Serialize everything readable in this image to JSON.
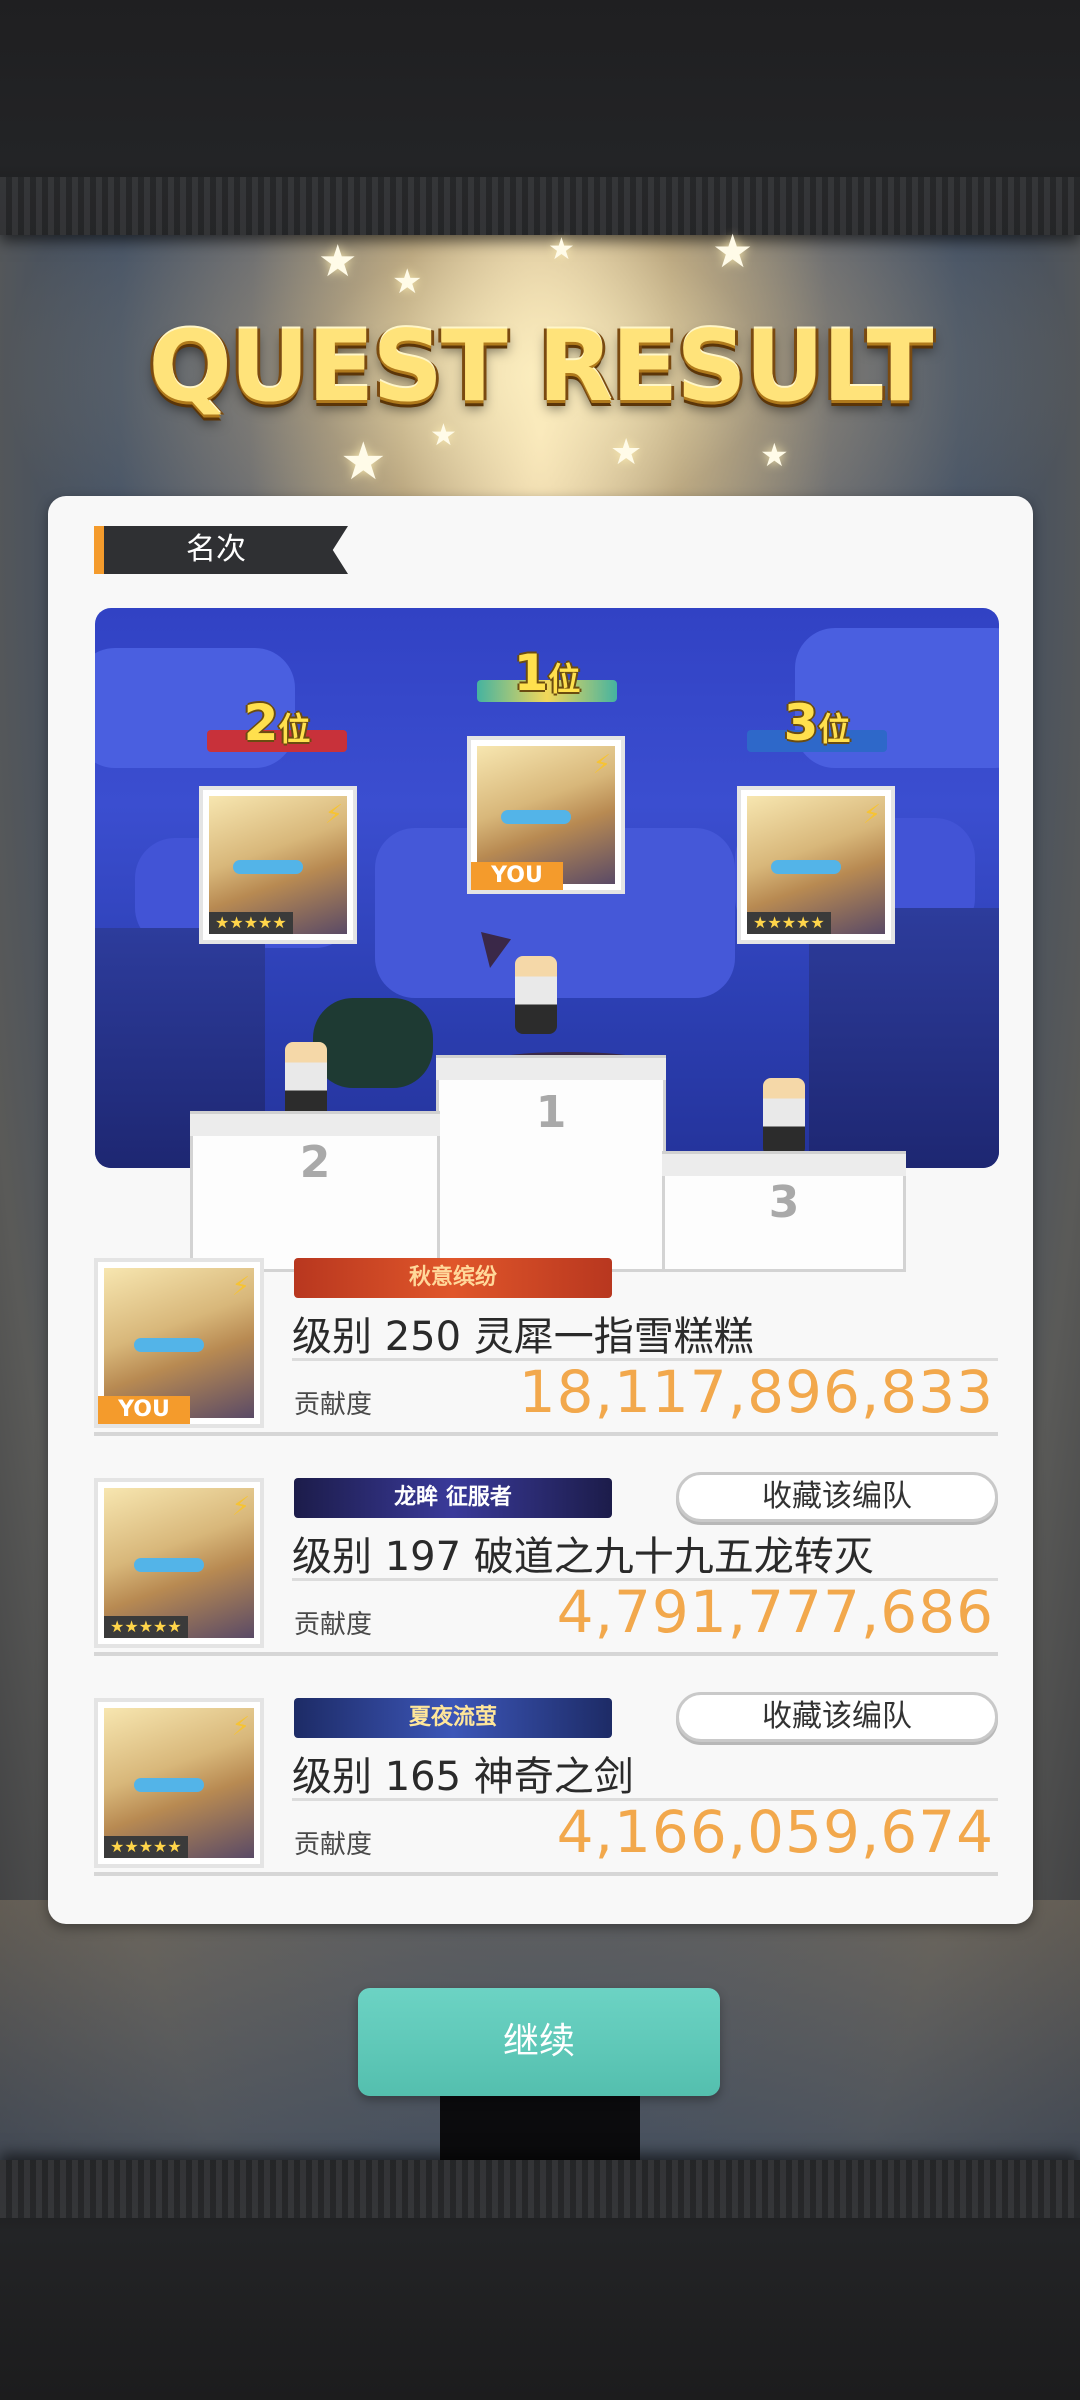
{
  "header": {
    "title": "QUEST RESULT"
  },
  "rank_section": {
    "label": "名次"
  },
  "podium": {
    "first": {
      "rank_num": "1",
      "rank_suffix": "位",
      "you_badge": "YOU",
      "stage_label": "1"
    },
    "second": {
      "rank_num": "2",
      "rank_suffix": "位",
      "stars": "★★★★★",
      "stage_label": "2"
    },
    "third": {
      "rank_num": "3",
      "rank_suffix": "位",
      "stars": "★★★★★",
      "stage_label": "3"
    }
  },
  "players": [
    {
      "title_badge": "秋意缤纷",
      "name": "级别 250 灵犀一指雪糕糕",
      "contribution_label": "贡献度",
      "contribution": "18,117,896,833",
      "you_badge": "YOU"
    },
    {
      "title_badge": "龙眸 征服者",
      "name": "级别 197 破道之九十九五龙转灭",
      "contribution_label": "贡献度",
      "contribution": "4,791,777,686",
      "stars": "★★★★★",
      "favorite_button": "收藏该编队"
    },
    {
      "title_badge": "夏夜流萤",
      "name": "级别 165 神奇之剑",
      "contribution_label": "贡献度",
      "contribution": "4,166,059,674",
      "stars": "★★★★★",
      "favorite_button": "收藏该编队"
    }
  ],
  "footer": {
    "continue_button": "继续"
  },
  "colors": {
    "accent_orange": "#f49b2c",
    "contribution_orange": "#f2a84c",
    "continue_teal": "#5fc9b9",
    "scene_blue": "#3142c4"
  }
}
